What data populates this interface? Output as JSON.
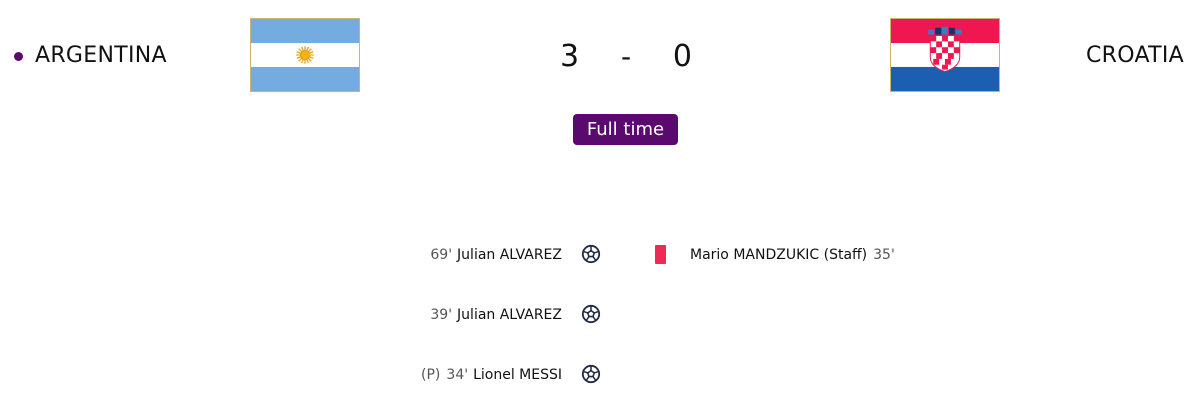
{
  "match": {
    "home": {
      "name": "ARGENTINA",
      "score": "3",
      "flag": "argentina-flag"
    },
    "away": {
      "name": "CROATIA",
      "score": "0",
      "flag": "croatia-flag"
    },
    "separator": "-",
    "status": "Full time",
    "colors": {
      "accent": "#5a0a6e",
      "red_card": "#ee2a55"
    }
  },
  "events": {
    "home": [
      {
        "minute": "69'",
        "player": "Julian ALVAREZ",
        "type": "goal",
        "penalty": "",
        "icon": "soccer-ball-icon"
      },
      {
        "minute": "39'",
        "player": "Julian ALVAREZ",
        "type": "goal",
        "penalty": "",
        "icon": "soccer-ball-icon"
      },
      {
        "minute": "34'",
        "player": "Lionel MESSI",
        "type": "goal",
        "penalty": "(P)",
        "icon": "soccer-ball-icon"
      }
    ],
    "away": [
      {
        "minute": "35'",
        "player": "Mario MANDZUKIC (Staff)",
        "type": "red-card",
        "icon": "red-card-icon"
      }
    ]
  }
}
